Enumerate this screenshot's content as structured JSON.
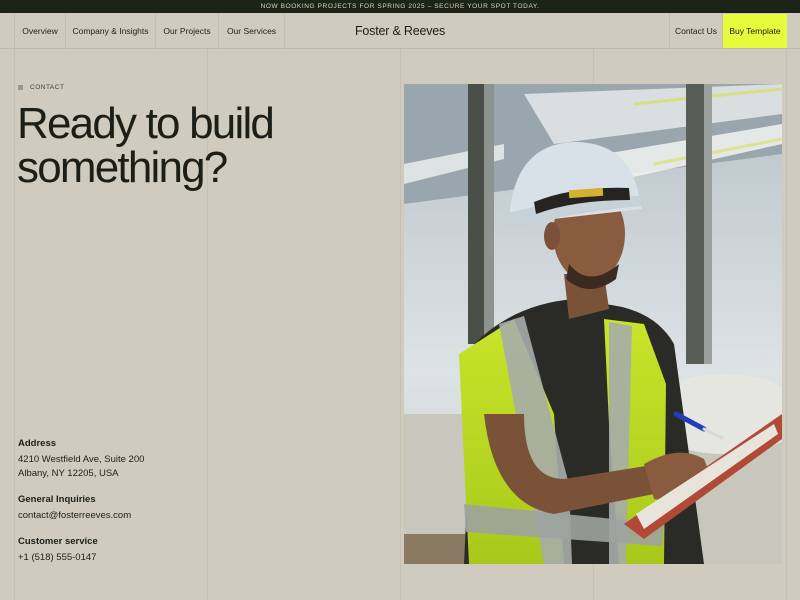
{
  "announcement": "Now booking projects for Spring 2025 – Secure your spot today.",
  "nav": {
    "items": [
      "Overview",
      "Company & Insights",
      "Our Projects",
      "Our Services"
    ],
    "brand": "Foster & Reeves",
    "contact": "Contact Us",
    "buy": "Buy Template"
  },
  "hero": {
    "eyebrow": "Contact",
    "headline_line1": "Ready to build",
    "headline_line2": "something?"
  },
  "contact": {
    "address_label": "Address",
    "address_line1": "4210 Westfield Ave, Suite 200",
    "address_line2": "Albany, NY 12205, USA",
    "inquiries_label": "General Inquiries",
    "inquiries_email": "contact@fosterreeves.com",
    "service_label": "Customer service",
    "service_phone": "+1 (518) 555-0147"
  },
  "colors": {
    "background": "#cfccbf",
    "announce_bar": "#1d2316",
    "accent": "#e6fb3c"
  },
  "photo_subject": "construction-worker-photo"
}
